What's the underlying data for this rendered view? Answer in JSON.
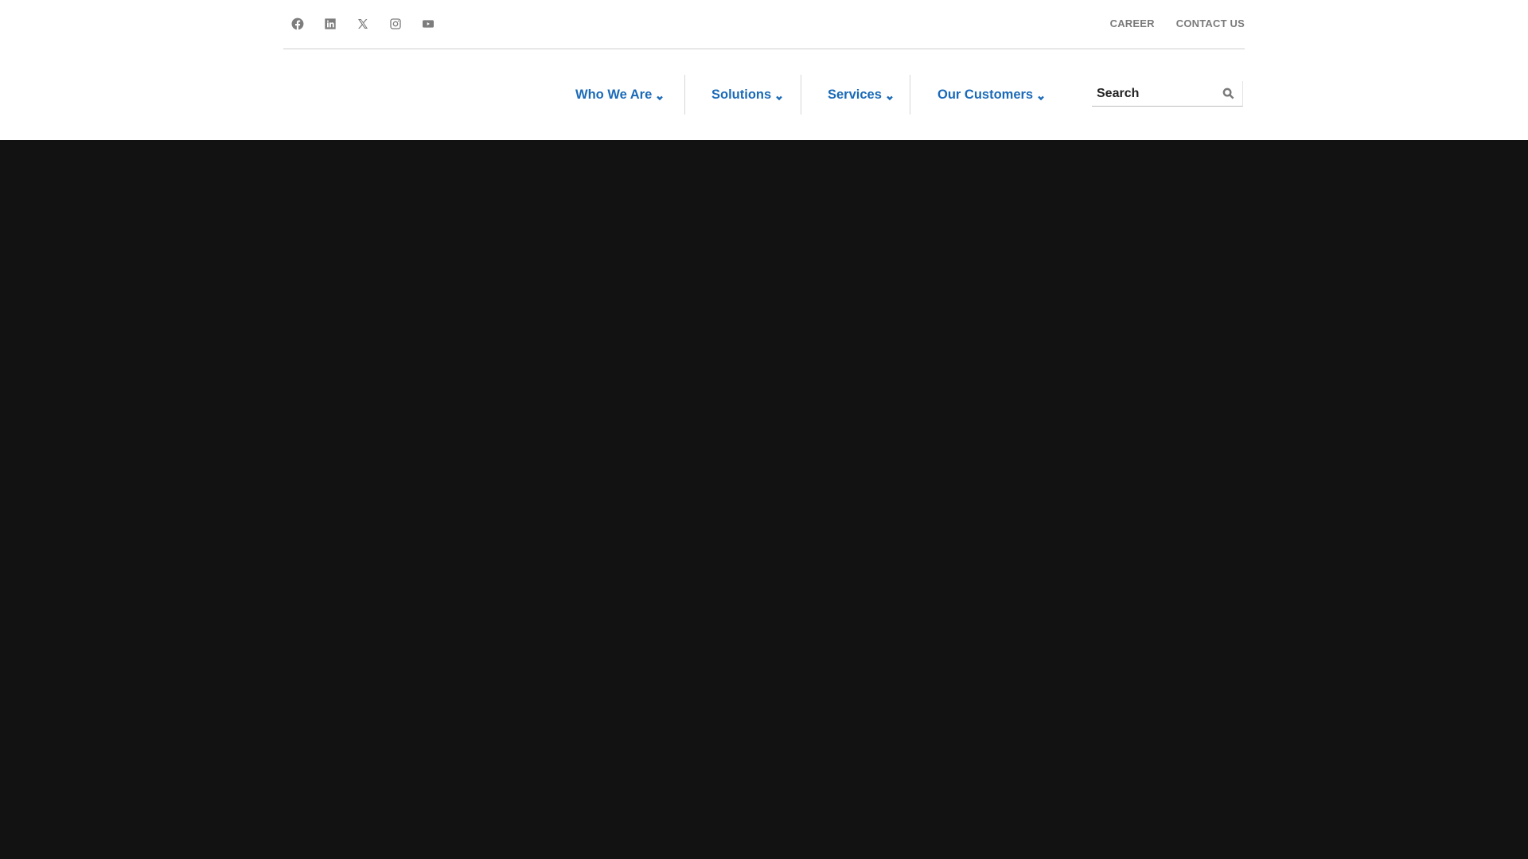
{
  "social_links": [
    {
      "name": "facebook",
      "icon": "facebook-icon"
    },
    {
      "name": "linkedin",
      "icon": "linkedin-icon"
    },
    {
      "name": "x",
      "icon": "x-icon"
    },
    {
      "name": "instagram",
      "icon": "instagram-icon"
    },
    {
      "name": "youtube",
      "icon": "youtube-icon"
    }
  ],
  "top_links": {
    "career": "CAREER",
    "contact": "CONTACT US"
  },
  "nav": {
    "items": [
      {
        "label": "Who We Are",
        "icon": "chevron-down-icon"
      },
      {
        "label": "Solutions",
        "icon": "chevron-down-icon"
      },
      {
        "label": "Services",
        "icon": "chevron-down-icon"
      },
      {
        "label": "Our Customers",
        "icon": "chevron-down-icon"
      }
    ]
  },
  "search": {
    "placeholder": "Search",
    "value": "",
    "icon": "search-icon"
  },
  "colors": {
    "nav_link": "#1a6ab8",
    "social_icon": "#7d7d7d",
    "hero_background": "#121212"
  }
}
